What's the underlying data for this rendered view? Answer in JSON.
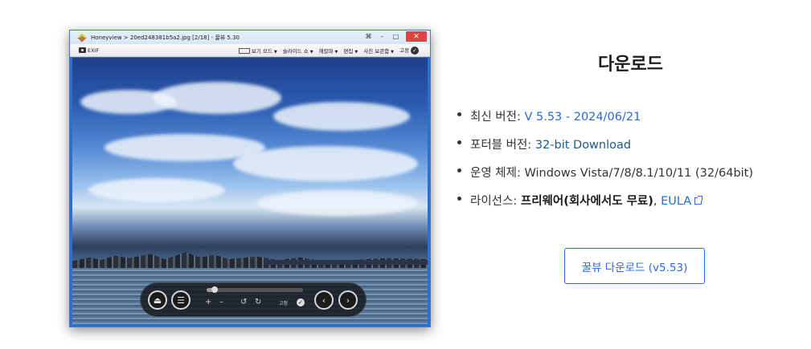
{
  "viewer": {
    "title": "Honeyview > 20ed248381b5a2.jpg [2/18] - 꿀뷰 5.30",
    "window_controls": [
      "⌘",
      "–",
      "□",
      "✕"
    ],
    "toolbar": {
      "exif_label": "EXIF",
      "menus": [
        {
          "label": "보기 모드"
        },
        {
          "label": "슬라이드 쇼"
        },
        {
          "label": "해칼파"
        },
        {
          "label": "편집"
        },
        {
          "label": "사진 보관함"
        }
      ],
      "pin_label": "고정",
      "pin_icon": "check-circle-icon"
    },
    "controlbar": {
      "progress": 0.08,
      "pin_label": "고정"
    }
  },
  "download": {
    "heading": "다운로드",
    "items": [
      {
        "label": "최신 버전: ",
        "value": "V 5.53 - 2024/06/21"
      },
      {
        "label": "포터블 버전: ",
        "value": "32-bit Download"
      },
      {
        "label": "운영 체제: ",
        "value": "Windows Vista/7/8/8.1/10/11 (32/64bit)"
      },
      {
        "label": "라이선스: ",
        "value": "프리웨어(회사에서도 무료)",
        "separator": ", ",
        "link": "EULA"
      }
    ],
    "button_label": "꿀뷰 다운로드 (v5.53)"
  },
  "colors": {
    "link": "#2a6bd6",
    "link_dark": "#1c5b86",
    "close_button": "#e04343",
    "window_border": "#3a7bd5"
  }
}
